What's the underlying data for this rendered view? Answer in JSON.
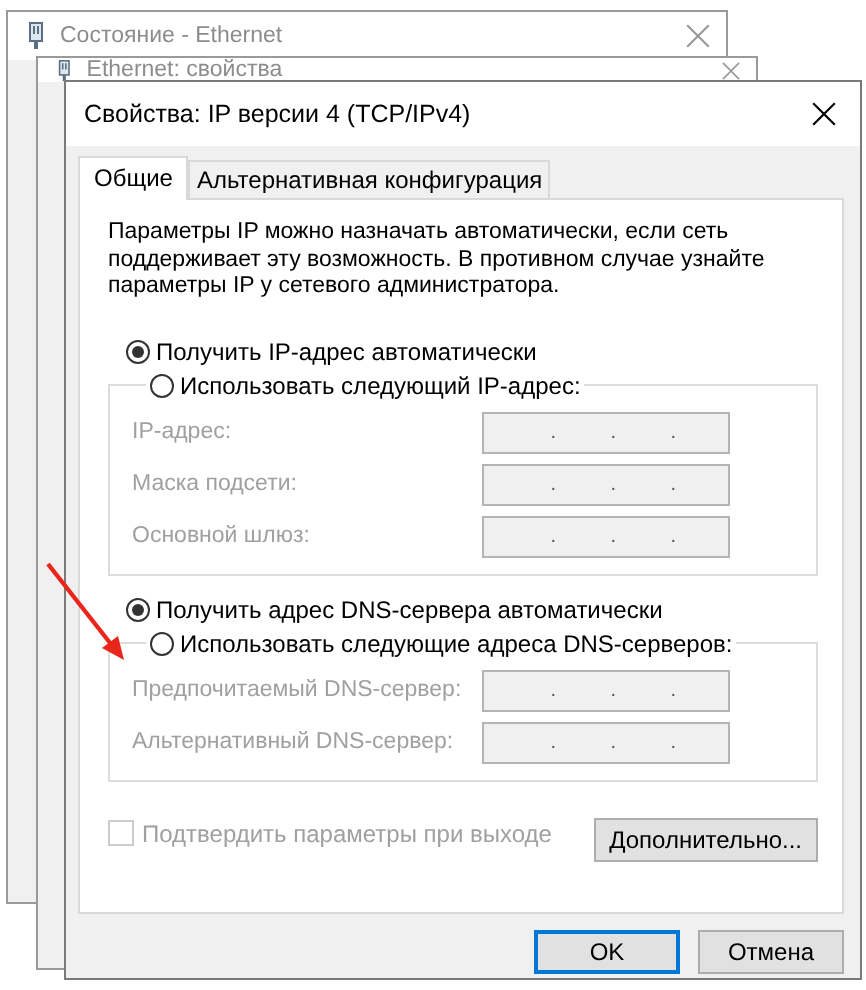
{
  "background_windows": [
    {
      "title": "Состояние - Ethernet"
    },
    {
      "title": "Ethernet: свойства"
    }
  ],
  "dialog": {
    "title": "Свойства: IP версии 4 (TCP/IPv4)",
    "tabs": [
      {
        "label": "Общие",
        "selected": true
      },
      {
        "label": "Альтернативная конфигурация",
        "selected": false
      }
    ],
    "description": "Параметры IP можно назначать автоматически, если сеть поддерживает эту возможность. В противном случае узнайте параметры IP у сетевого администратора.",
    "sections": [
      {
        "options": [
          {
            "label": "Получить IP-адрес автоматически",
            "selected": true
          },
          {
            "label": "Использовать следующий IP-адрес:",
            "selected": false
          }
        ],
        "fields": [
          {
            "label": "IP-адрес:",
            "disabled": true,
            "separators": [
              ".",
              ".",
              "."
            ]
          },
          {
            "label": "Маска подсети:",
            "disabled": true,
            "separators": [
              ".",
              ".",
              "."
            ]
          },
          {
            "label": "Основной шлюз:",
            "disabled": true,
            "separators": [
              ".",
              ".",
              "."
            ]
          }
        ]
      },
      {
        "options": [
          {
            "label": "Получить адрес DNS-сервера автоматически",
            "selected": true
          },
          {
            "label": "Использовать следующие адреса DNS-серверов:",
            "selected": false
          }
        ],
        "fields": [
          {
            "label": "Предпочитаемый DNS-сервер:",
            "disabled": true,
            "separators": [
              ".",
              ".",
              "."
            ]
          },
          {
            "label": "Альтернативный DNS-сервер:",
            "disabled": true,
            "separators": [
              ".",
              ".",
              "."
            ]
          }
        ]
      }
    ],
    "confirm_on_exit": {
      "label": "Подтвердить параметры при выходе",
      "checked": false,
      "disabled": true
    },
    "advanced_button": "Дополнительно...",
    "buttons": [
      {
        "label": "OK",
        "default": true
      },
      {
        "label": "Отмена",
        "default": false
      }
    ]
  }
}
